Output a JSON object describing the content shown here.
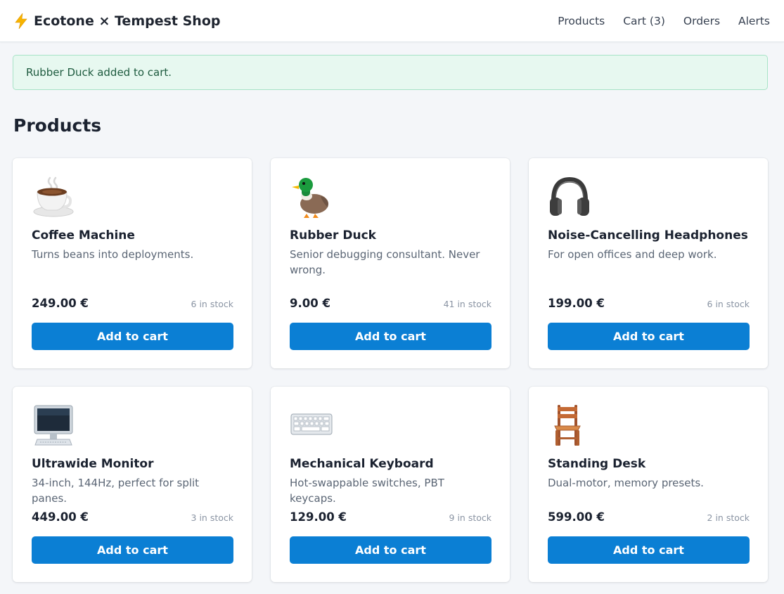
{
  "header": {
    "brand": "Ecotone × Tempest Shop",
    "nav": [
      "Products",
      "Cart (3)",
      "Orders",
      "Alerts"
    ]
  },
  "flash": {
    "message": "Rubber Duck added to cart."
  },
  "page": {
    "title": "Products"
  },
  "products": [
    {
      "icon": "coffee-cup-icon",
      "name": "Coffee Machine",
      "description": "Turns beans into deployments.",
      "price": "249.00 €",
      "stock": "6 in stock",
      "button": "Add to cart"
    },
    {
      "icon": "duck-icon",
      "name": "Rubber Duck",
      "description": "Senior debugging consultant. Never wrong.",
      "price": "9.00 €",
      "stock": "41 in stock",
      "button": "Add to cart"
    },
    {
      "icon": "headphones-icon",
      "name": "Noise-Cancelling Headphones",
      "description": "For open offices and deep work.",
      "price": "199.00 €",
      "stock": "6 in stock",
      "button": "Add to cart"
    },
    {
      "icon": "monitor-icon",
      "name": "Ultrawide Monitor",
      "description": "34-inch, 144Hz, perfect for split panes.",
      "price": "449.00 €",
      "stock": "3 in stock",
      "button": "Add to cart"
    },
    {
      "icon": "keyboard-icon",
      "name": "Mechanical Keyboard",
      "description": "Hot-swappable switches, PBT keycaps.",
      "price": "129.00 €",
      "stock": "9 in stock",
      "button": "Add to cart"
    },
    {
      "icon": "chair-icon",
      "name": "Standing Desk",
      "description": "Dual-motor, memory presets.",
      "price": "599.00 €",
      "stock": "2 in stock",
      "button": "Add to cart"
    }
  ],
  "colors": {
    "accent": "#0b7fd4",
    "flash_bg": "#e7f8f0",
    "flash_border": "#a7e3c6",
    "flash_text": "#1e5b3f"
  }
}
